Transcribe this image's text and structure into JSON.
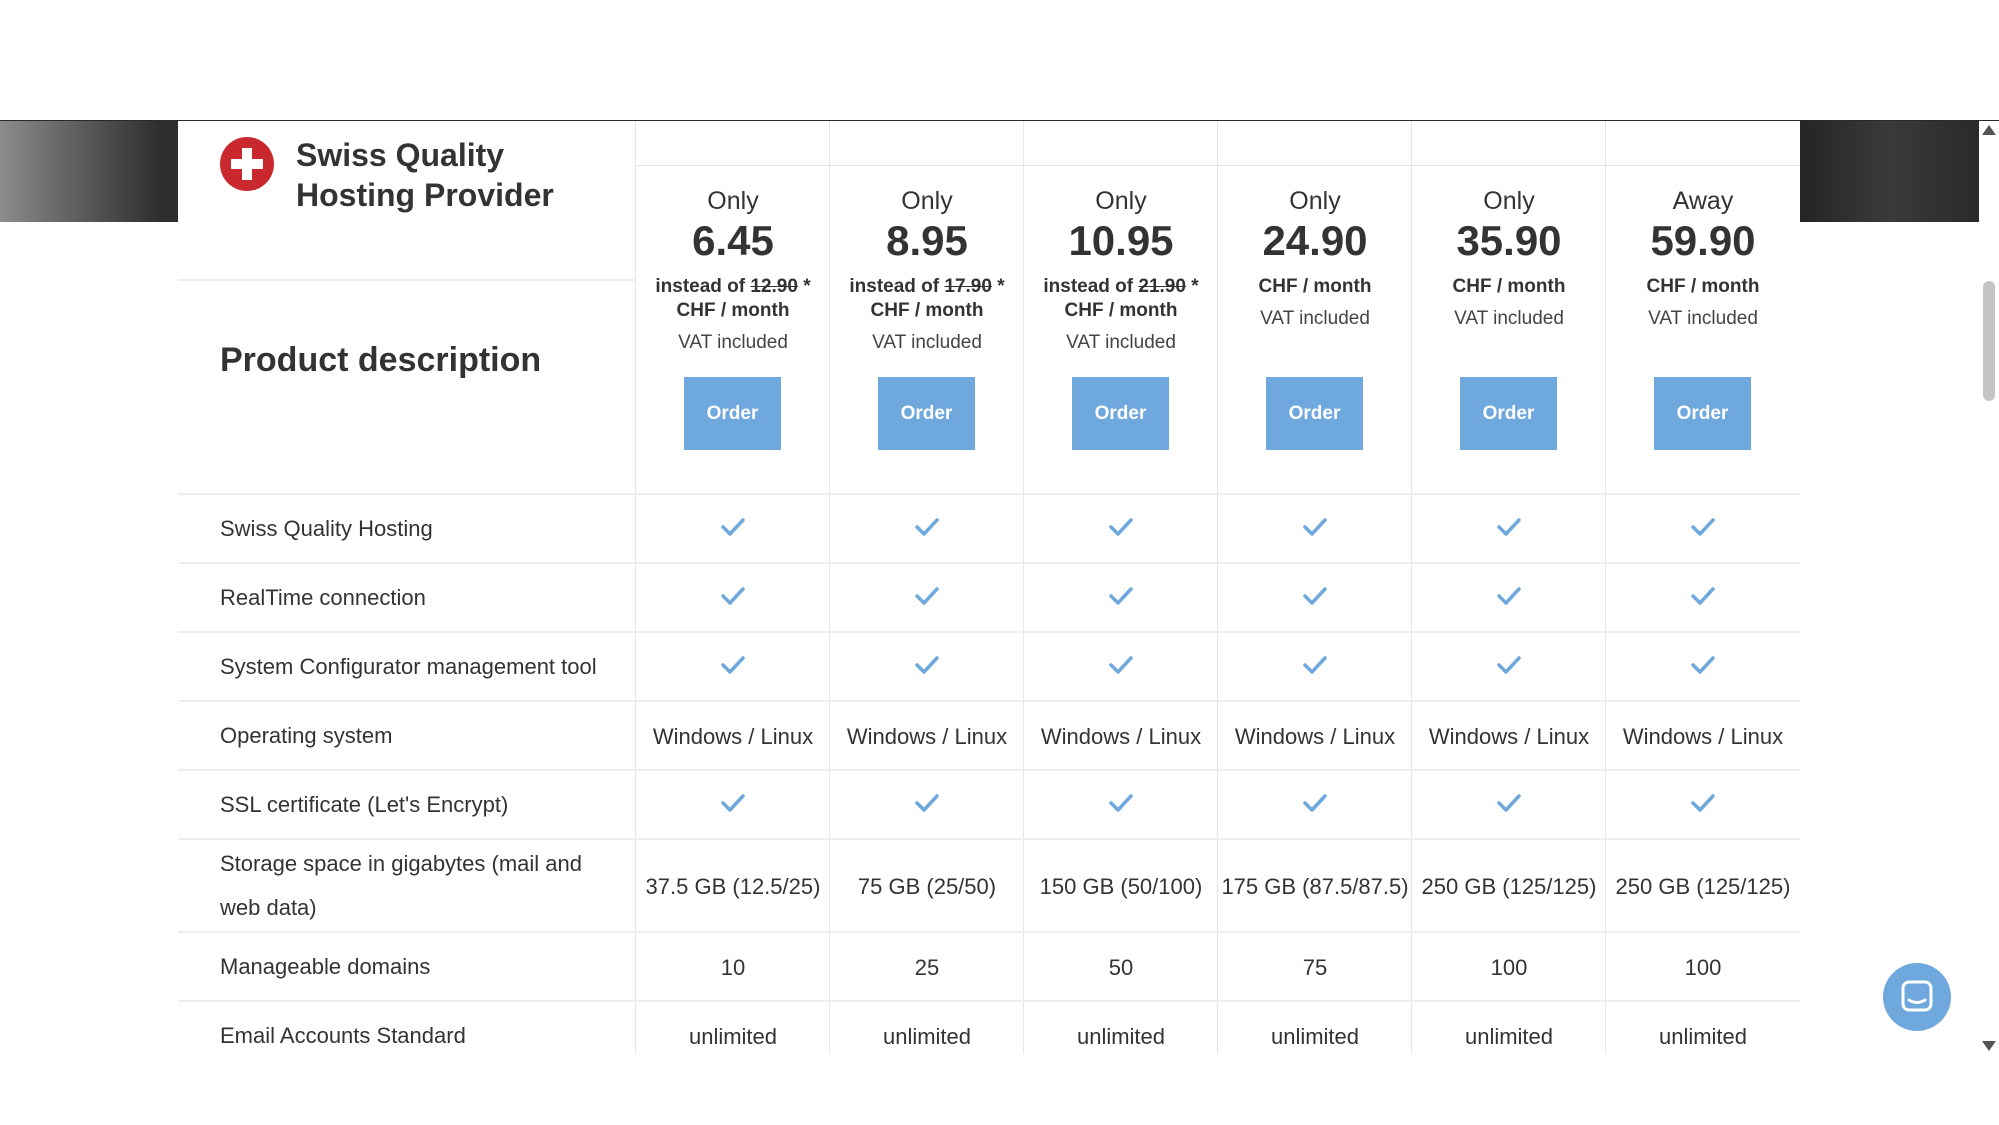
{
  "brand": {
    "title": "Swiss Quality Hosting Provider"
  },
  "product_description_label": "Product description",
  "order_label": "Order",
  "plans": [
    {
      "prefix": "Only",
      "price": "6.45",
      "instead_label": "instead of",
      "old_price": "12.90",
      "asterisk": "*",
      "period": "CHF / month",
      "vat": "VAT included"
    },
    {
      "prefix": "Only",
      "price": "8.95",
      "instead_label": "instead of",
      "old_price": "17.90",
      "asterisk": "*",
      "period": "CHF / month",
      "vat": "VAT included"
    },
    {
      "prefix": "Only",
      "price": "10.95",
      "instead_label": "instead of",
      "old_price": "21.90",
      "asterisk": "*",
      "period": "CHF / month",
      "vat": "VAT included"
    },
    {
      "prefix": "Only",
      "price": "24.90",
      "period": "CHF / month",
      "vat": "VAT included"
    },
    {
      "prefix": "Only",
      "price": "35.90",
      "period": "CHF / month",
      "vat": "VAT included"
    },
    {
      "prefix": "Away",
      "price": "59.90",
      "period": "CHF / month",
      "vat": "VAT included"
    }
  ],
  "features": [
    {
      "label": "Swiss Quality Hosting",
      "type": "check"
    },
    {
      "label": "RealTime connection",
      "type": "check"
    },
    {
      "label": "System Configurator management tool",
      "type": "check"
    },
    {
      "label": "Operating system",
      "type": "text",
      "values": [
        "Windows / Linux",
        "Windows / Linux",
        "Windows / Linux",
        "Windows / Linux",
        "Windows / Linux",
        "Windows / Linux"
      ]
    },
    {
      "label": "SSL certificate (Let's Encrypt)",
      "type": "check"
    },
    {
      "label": "Storage space in gigabytes (mail and web data)",
      "type": "text",
      "values": [
        "37.5 GB (12.5/25)",
        "75 GB (25/50)",
        "150 GB (50/100)",
        "175 GB (87.5/87.5)",
        "250 GB (125/125)",
        "250 GB (125/125)"
      ]
    },
    {
      "label": "Manageable domains",
      "type": "text",
      "values": [
        "10",
        "25",
        "50",
        "75",
        "100",
        "100"
      ]
    },
    {
      "label": "Email Accounts Standard",
      "type": "text",
      "values": [
        "unlimited",
        "unlimited",
        "unlimited",
        "unlimited",
        "unlimited",
        "unlimited"
      ]
    }
  ],
  "colors": {
    "accent": "#6fa8dc",
    "brand_red": "#c8282e",
    "text": "#333333"
  },
  "icons": {
    "check": "check-icon",
    "logo": "swiss-cross-icon",
    "chat": "chat-icon"
  }
}
